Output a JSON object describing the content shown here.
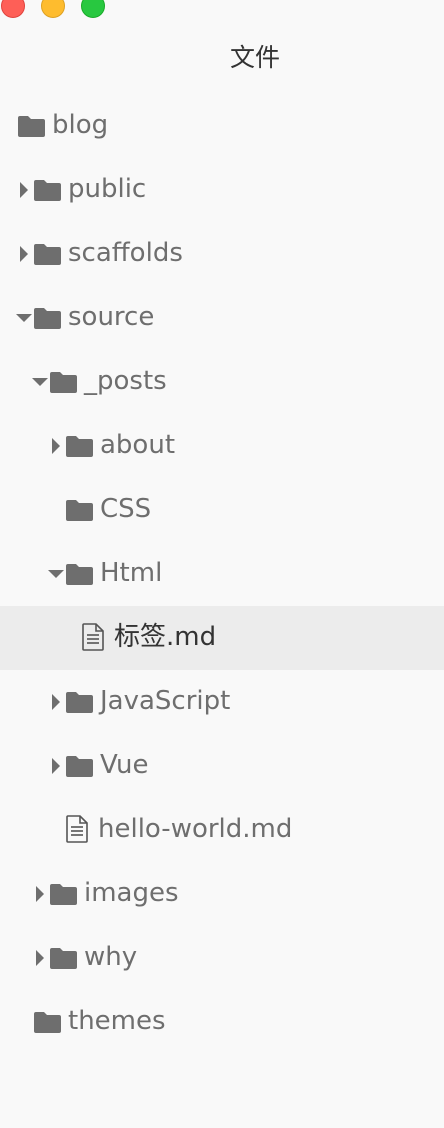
{
  "window": {
    "title": "文件"
  },
  "tree": [
    {
      "name": "blog",
      "type": "folder",
      "depth": 0,
      "state": "none"
    },
    {
      "name": "public",
      "type": "folder",
      "depth": 1,
      "state": "collapsed"
    },
    {
      "name": "scaffolds",
      "type": "folder",
      "depth": 1,
      "state": "collapsed"
    },
    {
      "name": "source",
      "type": "folder",
      "depth": 1,
      "state": "expanded"
    },
    {
      "name": "_posts",
      "type": "folder",
      "depth": 2,
      "state": "expanded"
    },
    {
      "name": "about",
      "type": "folder",
      "depth": 3,
      "state": "collapsed"
    },
    {
      "name": "CSS",
      "type": "folder",
      "depth": 3,
      "state": "none"
    },
    {
      "name": "Html",
      "type": "folder",
      "depth": 3,
      "state": "expanded"
    },
    {
      "name": "标签.md",
      "type": "file",
      "depth": 4,
      "state": "none",
      "selected": true
    },
    {
      "name": "JavaScript",
      "type": "folder",
      "depth": 3,
      "state": "collapsed"
    },
    {
      "name": "Vue",
      "type": "folder",
      "depth": 3,
      "state": "collapsed"
    },
    {
      "name": "hello-world.md",
      "type": "file",
      "depth": 3,
      "state": "none"
    },
    {
      "name": "images",
      "type": "folder",
      "depth": 2,
      "state": "collapsed"
    },
    {
      "name": "why",
      "type": "folder",
      "depth": 2,
      "state": "collapsed"
    },
    {
      "name": "themes",
      "type": "folder",
      "depth": 1,
      "state": "none"
    }
  ],
  "icons": {
    "folder": "folder-icon",
    "file": "file-icon",
    "collapsed": "chevron-right-icon",
    "expanded": "chevron-down-icon"
  },
  "colors": {
    "background": "#f9f9f9",
    "selected_row": "#ececec",
    "icon": "#6e6e6e",
    "text": "#6e6e6e"
  }
}
